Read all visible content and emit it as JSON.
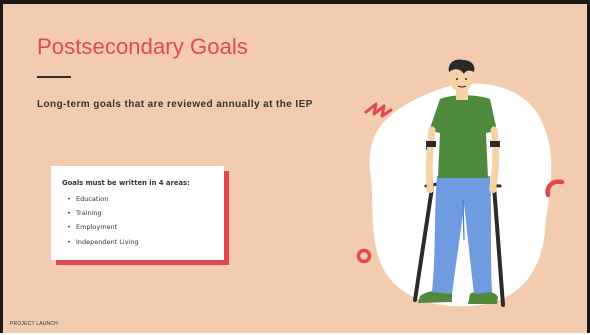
{
  "slide": {
    "title": "Postsecondary Goals",
    "subtitle": "Long-term goals that are reviewed annually at the IEP",
    "card": {
      "heading": "Goals must be written in 4 areas:",
      "items": [
        "Education",
        "Training",
        "Employment",
        "Independent Living"
      ]
    },
    "footer": "PROJECT LAUNCH",
    "bullet_glyph": "•"
  },
  "colors": {
    "background": "#f3ccb0",
    "accent": "#e3484f",
    "blob": "#ffffff",
    "shirt": "#4f8a3c",
    "pants": "#6f9be0",
    "skin": "#f6d3a6",
    "hair": "#2a2a2a"
  },
  "illustration": {
    "subject": "man-with-forearm-crutches",
    "decorations": [
      "zigzag-line",
      "ring",
      "arc"
    ]
  }
}
